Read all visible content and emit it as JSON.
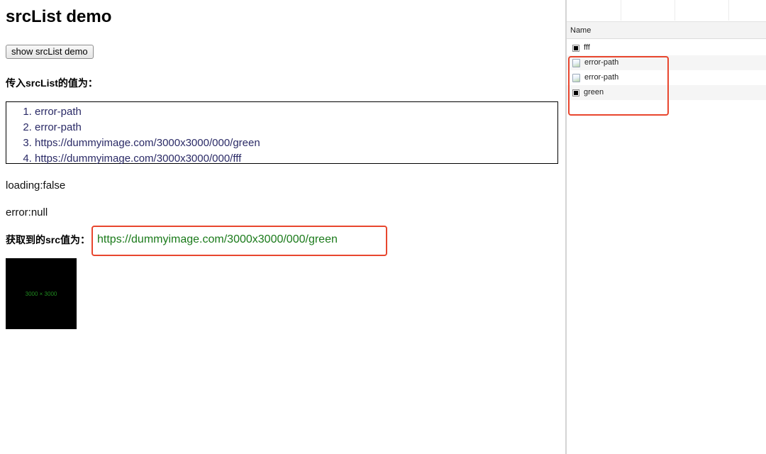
{
  "demo": {
    "title": "srcList demo",
    "show_button": "show srcList demo",
    "list_heading": "传入srcList的值为：",
    "src_list": [
      "error-path",
      "error-path",
      "https://dummyimage.com/3000x3000/000/green",
      "https://dummyimage.com/3000x3000/000/fff"
    ],
    "loading": "loading:false",
    "error": "error:null",
    "src_label": "获取到的src值为：",
    "src_value": "https://dummyimage.com/3000x3000/000/green",
    "preview_text": "3000 × 3000",
    "preview_bg": "#000000",
    "preview_fg": "#1f8a1f"
  },
  "devtools": {
    "column_name": "Name",
    "requests": [
      {
        "name": "fff",
        "icon": "black-square-icon"
      },
      {
        "name": "error-path",
        "icon": "broken-image-icon"
      },
      {
        "name": "error-path",
        "icon": "broken-image-icon"
      },
      {
        "name": "green",
        "icon": "black-square-icon"
      }
    ]
  },
  "highlight_color": "#e8462e"
}
